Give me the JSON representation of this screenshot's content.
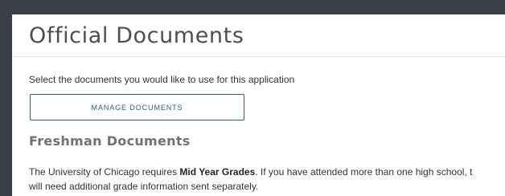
{
  "page": {
    "title": "Official Documents",
    "intro": "Select the documents you would like to use for this application"
  },
  "actions": {
    "manage_documents_label": "MANAGE DOCUMENTS"
  },
  "section": {
    "title": "Freshman Documents",
    "line1_before": "The University of Chicago requires ",
    "line1_bold": "Mid Year Grades",
    "line1_after": ". If you have attended more than one high school, t",
    "line2": "will need additional grade information sent separately."
  }
}
